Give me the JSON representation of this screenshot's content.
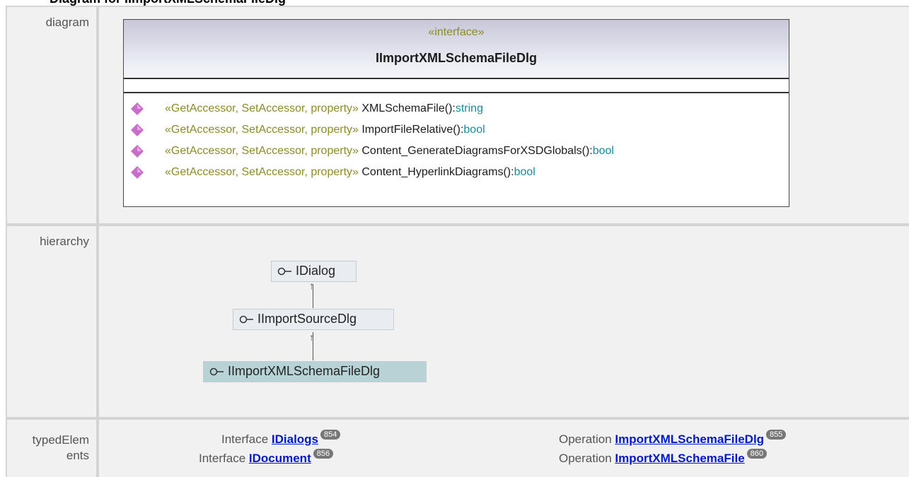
{
  "page": {
    "clipped_heading": "Diagram for IImportXMLSchemaFileDlg"
  },
  "rows": {
    "diagram_label": "diagram",
    "hierarchy_label": "hierarchy",
    "typed_label_line1": "typedElem",
    "typed_label_line2": "ents"
  },
  "uml": {
    "stereotype": "«interface»",
    "class_name": "IImportXMLSchemaFileDlg",
    "operations": [
      {
        "stereotype": "«GetAccessor, SetAccessor, property»",
        "name": "XMLSchemaFile()",
        "sep": ":",
        "type": "string"
      },
      {
        "stereotype": "«GetAccessor, SetAccessor, property»",
        "name": "ImportFileRelative()",
        "sep": ":",
        "type": "bool"
      },
      {
        "stereotype": "«GetAccessor, SetAccessor, property»",
        "name": "Content_GenerateDiagramsForXSDGlobals()",
        "sep": ":",
        "type": "bool"
      },
      {
        "stereotype": "«GetAccessor, SetAccessor, property»",
        "name": "Content_HyperlinkDiagrams()",
        "sep": ":",
        "type": "bool"
      }
    ],
    "colors": {
      "stereotype": "#8c8c28",
      "type": "#1a8a9a",
      "operation_icon": "#c86ec8"
    }
  },
  "hierarchy": {
    "nodes": [
      "IDialog",
      "IImportSourceDlg",
      "IImportXMLSchemaFileDlg"
    ],
    "selected": "IImportXMLSchemaFileDlg",
    "node_icon": "interface-lollipop-icon"
  },
  "typed_elements": {
    "left": [
      {
        "kind": "Interface",
        "name": "IDialogs",
        "page": "854"
      },
      {
        "kind": "Interface",
        "name": "IDocument",
        "page": "856"
      }
    ],
    "right": [
      {
        "kind": "Operation",
        "name": "ImportXMLSchemaFileDlg",
        "page": "855"
      },
      {
        "kind": "Operation",
        "name": "ImportXMLSchemaFile",
        "page": "860"
      }
    ]
  }
}
